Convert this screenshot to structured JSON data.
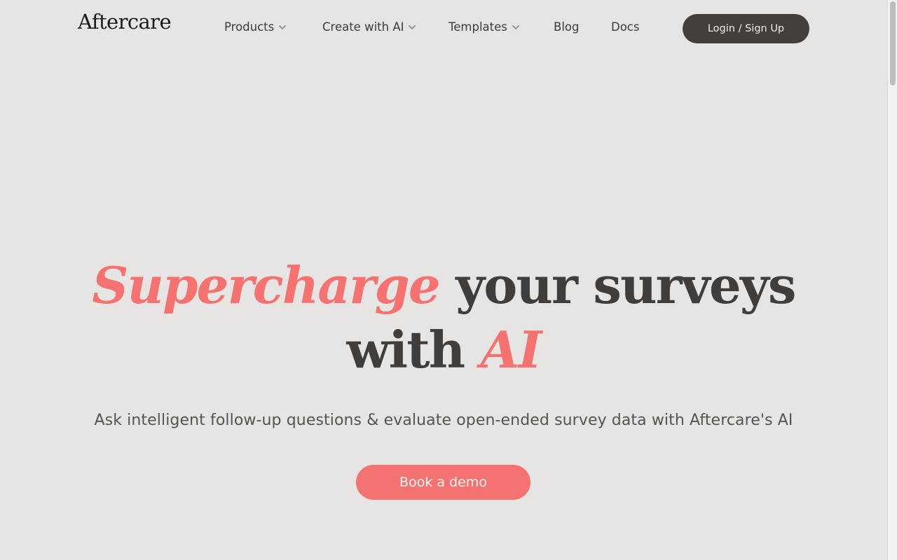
{
  "nav": {
    "logo_text": "Aftercare",
    "items": [
      {
        "label": "Products",
        "has_dropdown": true
      },
      {
        "label": "Create with AI",
        "has_dropdown": true
      },
      {
        "label": "Templates",
        "has_dropdown": true
      },
      {
        "label": "Blog",
        "has_dropdown": false
      },
      {
        "label": "Docs",
        "has_dropdown": false
      }
    ],
    "login_label": "Login / Sign Up"
  },
  "hero": {
    "title_accent_1": "Supercharge",
    "title_plain_1": "your surveys",
    "title_plain_2": "with",
    "title_accent_2": "AI",
    "subtitle": "Ask intelligent follow-up questions & evaluate open-ended survey data with Aftercare's AI",
    "cta_label": "Book a demo"
  },
  "colors": {
    "background": "#e7e5e3",
    "accent": "#f47370",
    "dark": "#423f3c",
    "text": "#403d3a"
  },
  "icons": {
    "dropdown": "chevron-down-icon",
    "logo_mark": "sparkle-icon"
  }
}
